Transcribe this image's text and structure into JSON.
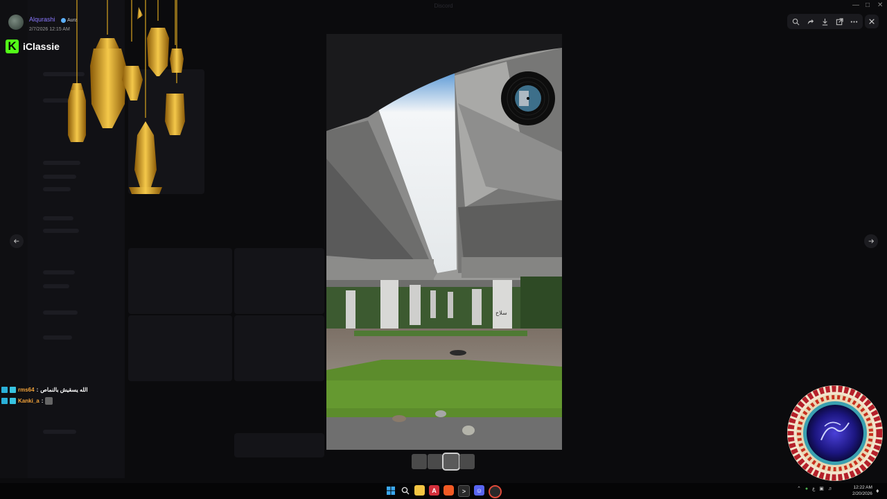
{
  "author": {
    "name": "Alqurashi",
    "badge": "Aura",
    "date": "2/7/2026 12:15 AM"
  },
  "overlay_brand": {
    "name": "iClassie"
  },
  "window": {
    "title": "Discord"
  },
  "toolbar": {
    "actions": [
      "zoom-icon",
      "forward-icon",
      "download-icon",
      "open-external-icon",
      "more-icon"
    ]
  },
  "chat": [
    {
      "user": "rms64",
      "separator": " : ",
      "text": "الله يسقيش بالنماص"
    },
    {
      "user": "Kanki_a",
      "separator": " : ",
      "text": ""
    }
  ],
  "taskbar": {
    "apps": [
      "windows-start-icon",
      "search-icon",
      "file-explorer-icon",
      "angular-app-icon",
      "brave-browser-icon",
      "terminal-icon",
      "discord-icon",
      "chrome-icon"
    ],
    "tray_lang": "ع",
    "time": "12:22 AM",
    "date": "2/20/2026"
  },
  "colors": {
    "accent_name": "#8a78ff",
    "kick_green": "#53fc18",
    "chat_user": "#f3a33a",
    "lantern_gold": "#d9a520"
  }
}
